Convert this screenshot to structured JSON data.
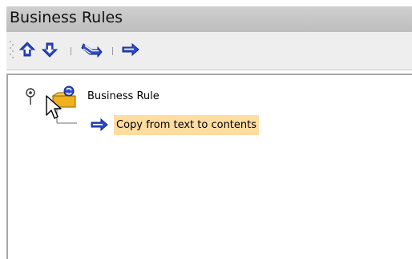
{
  "panel": {
    "title": "Business Rules"
  },
  "toolbar": {
    "buttons": [
      {
        "name": "move-up",
        "icon": "up-arrow-icon"
      },
      {
        "name": "move-down",
        "icon": "down-arrow-icon"
      },
      {
        "name": "indent",
        "icon": "double-arrow-icon"
      },
      {
        "name": "add-action",
        "icon": "right-arrow-icon"
      }
    ]
  },
  "tree": {
    "root": {
      "label": "Business Rule",
      "icon": "rule-folder-icon"
    },
    "children": [
      {
        "label": "Copy from text to contents",
        "icon": "right-arrow-icon",
        "selected": true
      }
    ]
  },
  "colors": {
    "icon_blue": "#2d4cc9",
    "selection": "#ffdca0",
    "title_bar": "#c4c4c4"
  }
}
